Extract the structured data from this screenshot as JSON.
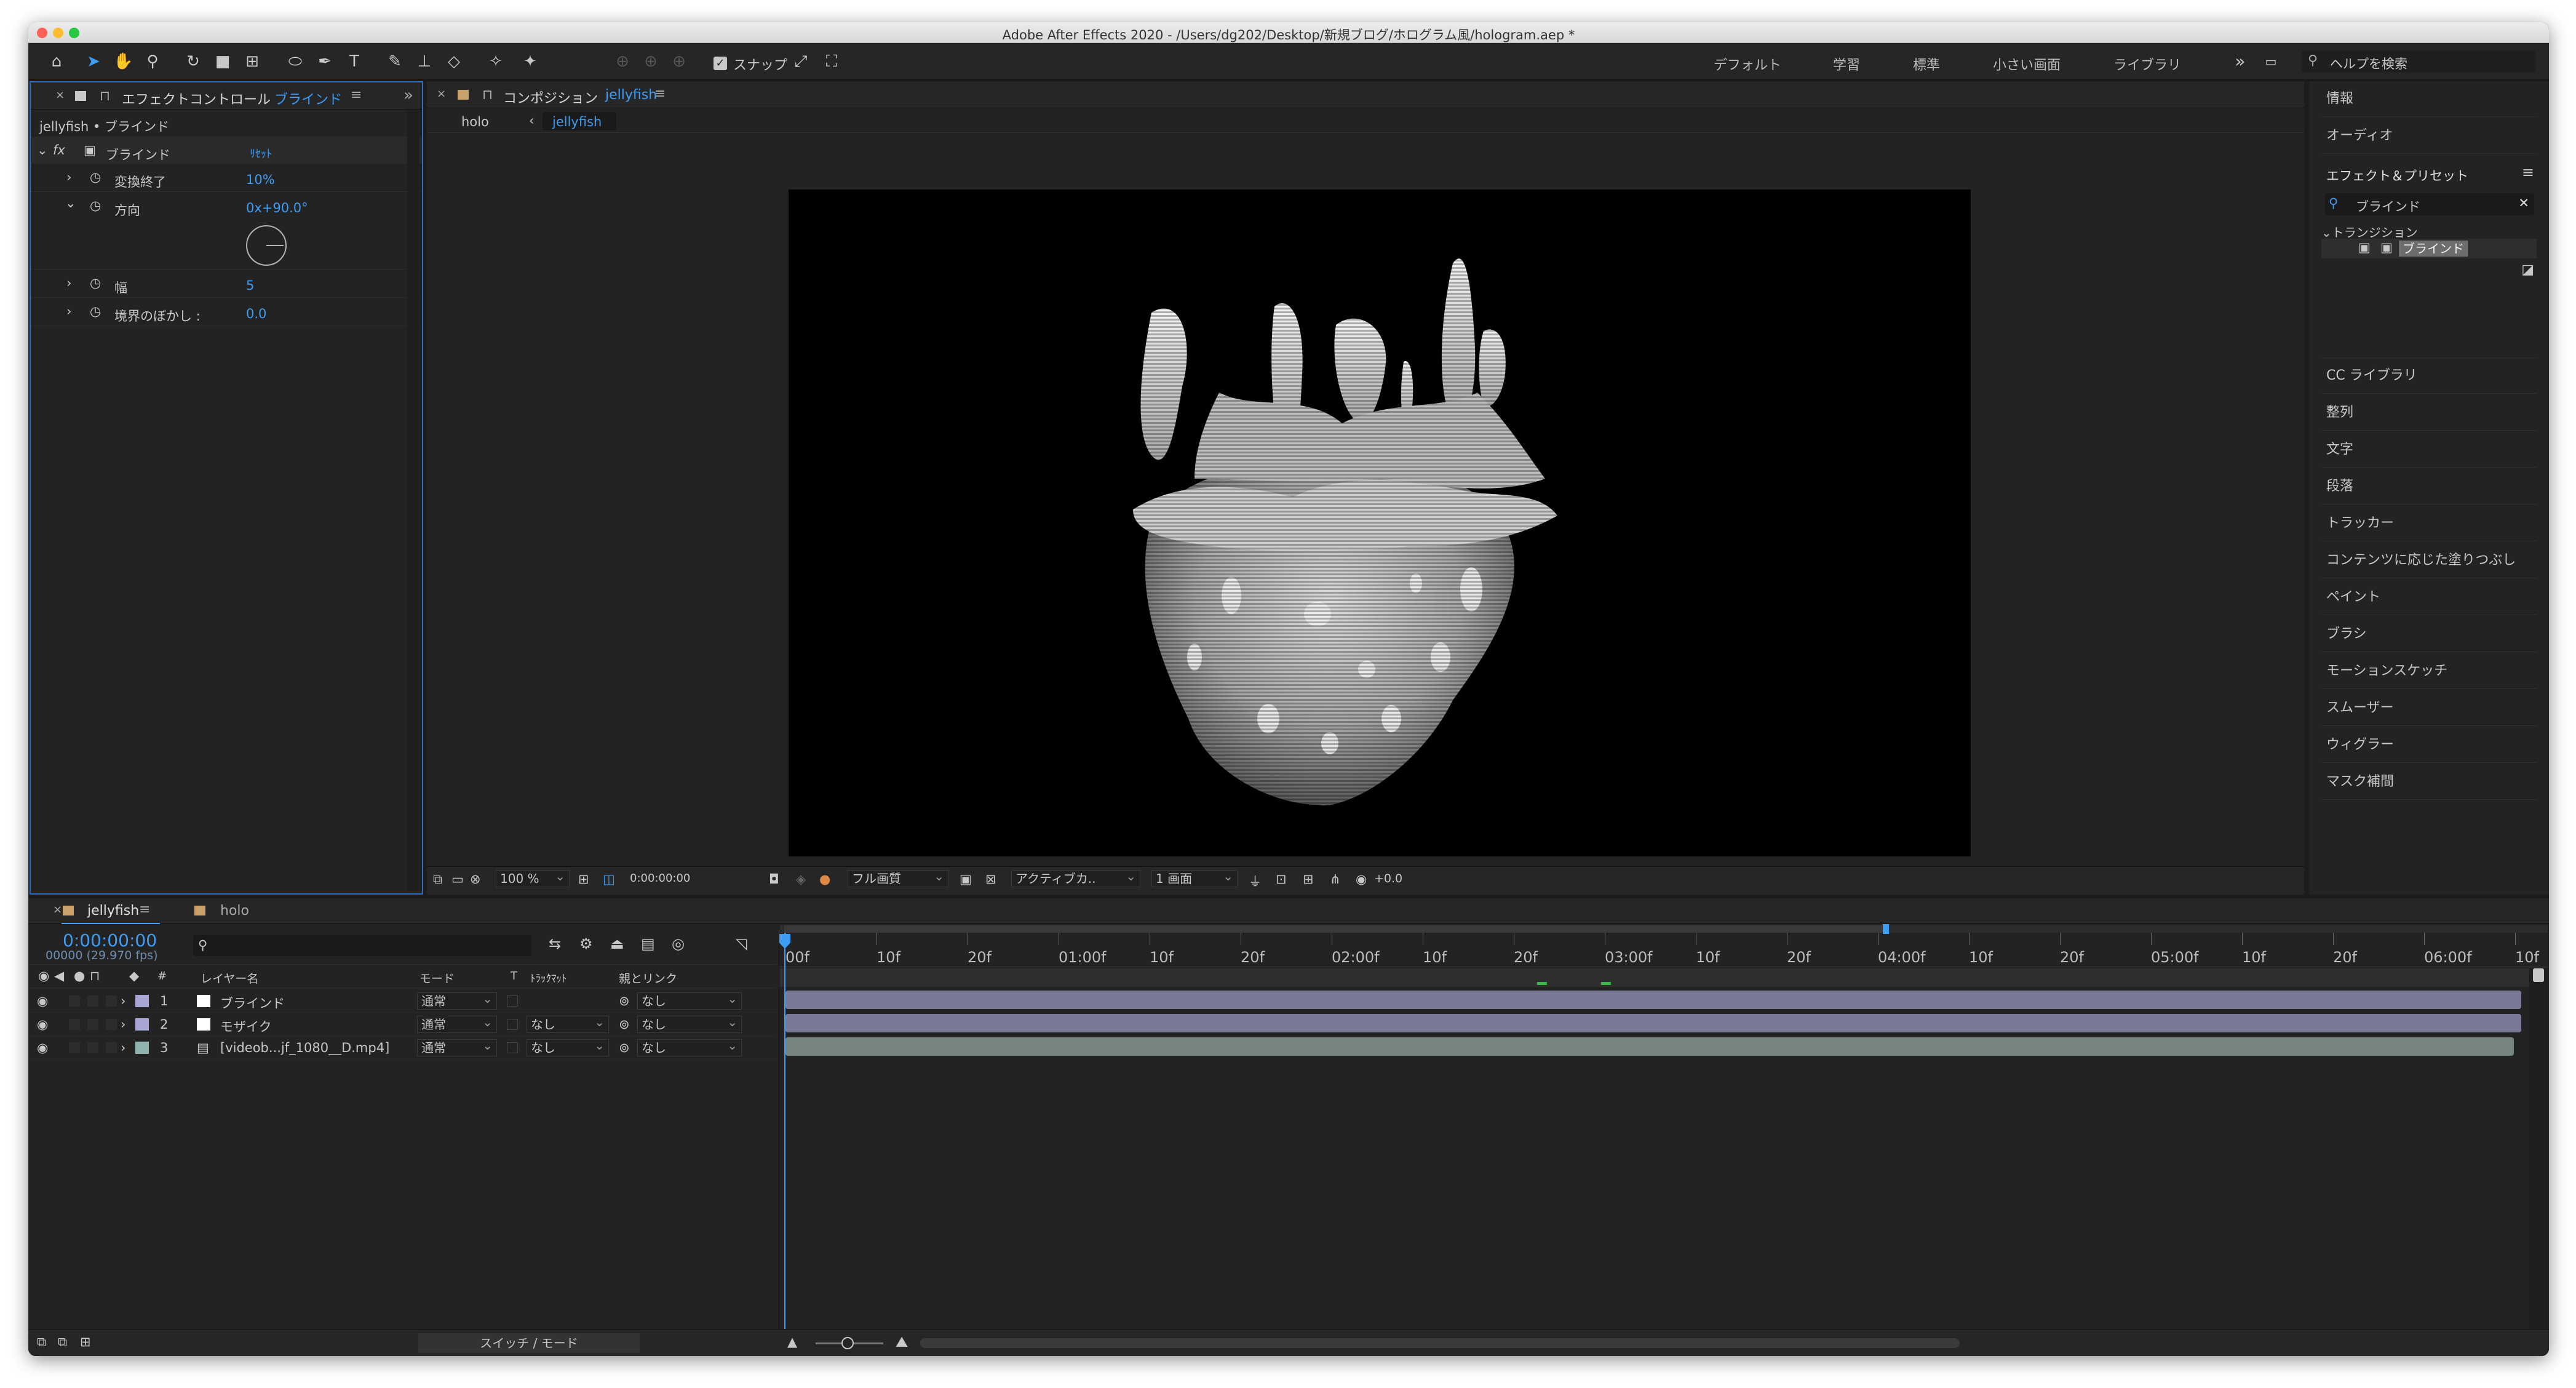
{
  "window": {
    "title": "Adobe After Effects 2020 - /Users/dg202/Desktop/新規ブログ/ホログラム風/hologram.aep *"
  },
  "toolbar": {
    "snap_label": "スナップ",
    "workspaces": [
      "デフォルト",
      "学習",
      "標準",
      "小さい画面",
      "ライブラリ"
    ],
    "more": "»",
    "help_placeholder": "ヘルプを検索"
  },
  "effect_controls": {
    "tab_label": "エフェクトコントロール",
    "tab_layer": "ブラインド",
    "header": "jellyfish • ブラインド",
    "effect_name": "ブラインド",
    "reset": "ﾘｾｯﾄ",
    "props": [
      {
        "name": "変換終了",
        "value": "10%"
      },
      {
        "name": "方向",
        "value": "0x+90.0°"
      },
      {
        "name": "幅",
        "value": "5"
      },
      {
        "name": "境界のぼかし :",
        "value": "0.0"
      }
    ]
  },
  "composition": {
    "tab_label": "コンポジション",
    "tab_comp": "jellyfish",
    "crumb_parent": "holo",
    "crumb_current": "jellyfish",
    "zoom": "100 %",
    "timecode": "0:00:00:00",
    "quality": "フル画質",
    "camera": "アクティブカ..",
    "views": "1 画面",
    "exposure": "+0.0"
  },
  "right_panel": {
    "items_top": [
      "情報",
      "オーディオ"
    ],
    "effects_title": "エフェクト＆プリセット",
    "search_value": "ブラインド",
    "category": "トランジション",
    "result": "ブラインド",
    "items_bottom": [
      "CC ライブラリ",
      "整列",
      "文字",
      "段落",
      "トラッカー",
      "コンテンツに応じた塗りつぶし",
      "ペイント",
      "ブラシ",
      "モーションスケッチ",
      "スムーザー",
      "ウィグラー",
      "マスク補間"
    ]
  },
  "timeline": {
    "tabs": [
      "jellyfish",
      "holo"
    ],
    "current_time": "0:00:00:00",
    "fps": "00000 (29.970 fps)",
    "columns": {
      "num": "#",
      "name": "レイヤー名",
      "mode": "モード",
      "t": "T",
      "trkmat": "ﾄﾗｯｸﾏｯﾄ",
      "parent": "親とリンク"
    },
    "layers": [
      {
        "num": "1",
        "name": "ブラインド",
        "mode": "通常",
        "trkmat": "",
        "parent": "なし",
        "color": "#a7a6d6"
      },
      {
        "num": "2",
        "name": "モザイク",
        "mode": "通常",
        "trkmat": "なし",
        "parent": "なし",
        "color": "#a7a6d6"
      },
      {
        "num": "3",
        "name": "[videob...jf_1080__D.mp4]",
        "mode": "通常",
        "trkmat": "なし",
        "parent": "なし",
        "color": "#8fb4b0"
      }
    ],
    "ruler": [
      "00f",
      "10f",
      "20f",
      "01:00f",
      "10f",
      "20f",
      "02:00f",
      "10f",
      "20f",
      "03:00f",
      "10f",
      "20f",
      "04:00f",
      "10f",
      "20f",
      "05:00f",
      "10f",
      "20f",
      "06:00f",
      "10f"
    ],
    "switch_mode": "スイッチ / モード"
  },
  "colors": {
    "accent": "#3d9cf4",
    "panel": "#232323",
    "bar_purple": "#7b7a96",
    "bar_teal": "#76857f"
  }
}
